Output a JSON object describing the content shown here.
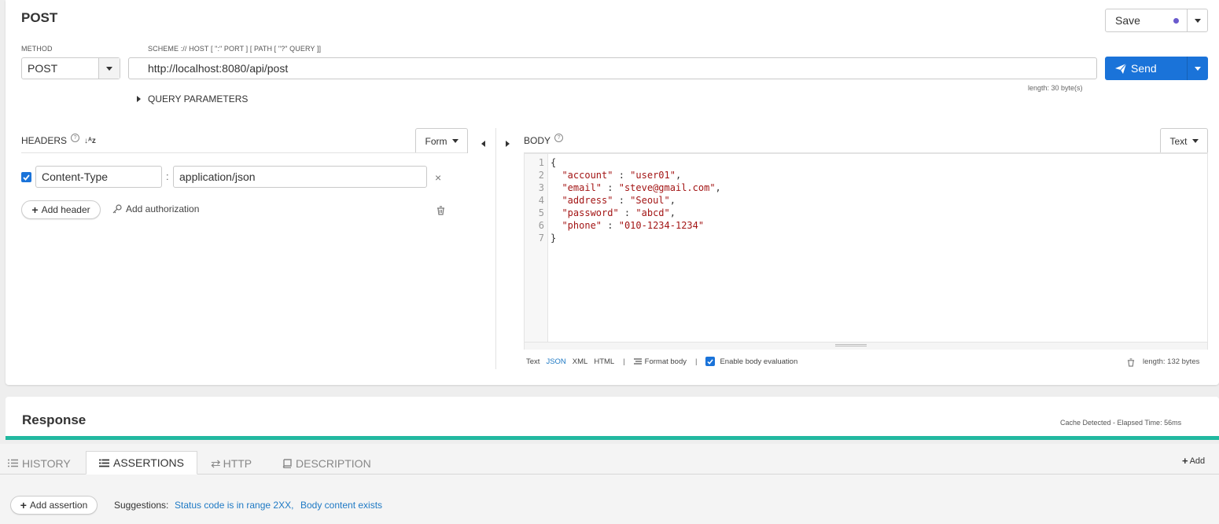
{
  "request": {
    "title": "POST",
    "save_label": "Save",
    "method_label": "METHOD",
    "method_value": "POST",
    "url_label": "SCHEME :// HOST [ \":\" PORT ] [ PATH [ \"?\" QUERY ]]",
    "url_value": "http://localhost:8080/api/post",
    "url_length": "length: 30 byte(s)",
    "send_label": "Send",
    "query_params_label": "QUERY PARAMETERS"
  },
  "headers": {
    "title": "HEADERS",
    "form_label": "Form",
    "rows": [
      {
        "checked": true,
        "name": "Content-Type",
        "value": "application/json"
      }
    ],
    "add_header_label": "Add header",
    "add_auth_label": "Add authorization"
  },
  "body": {
    "title": "BODY",
    "mode_label": "Text",
    "lines": [
      {
        "n": "1",
        "text": "{"
      },
      {
        "n": "2",
        "text": "  \"account\" : \"user01\","
      },
      {
        "n": "3",
        "text": "  \"email\" : \"steve@gmail.com\","
      },
      {
        "n": "4",
        "text": "  \"address\" : \"Seoul\","
      },
      {
        "n": "5",
        "text": "  \"password\" : \"abcd\","
      },
      {
        "n": "6",
        "text": "  \"phone\" : \"010-1234-1234\""
      },
      {
        "n": "7",
        "text": "}"
      }
    ],
    "formats": [
      "Text",
      "JSON",
      "XML",
      "HTML"
    ],
    "active_format": "JSON",
    "format_body_label": "Format body",
    "enable_eval_label": "Enable body evaluation",
    "length": "length: 132 bytes"
  },
  "response": {
    "title": "Response",
    "status": "Cache Detected - Elapsed Time: 56ms"
  },
  "tabs": {
    "history": "HISTORY",
    "assertions": "ASSERTIONS",
    "http": "HTTP",
    "description": "DESCRIPTION",
    "add": "Add"
  },
  "assertions": {
    "add_label": "Add assertion",
    "suggestions_label": "Suggestions:",
    "suggestion_1": "Status code is in range 2XX,",
    "suggestion_2": "Body content exists"
  },
  "colors": {
    "accent": "#1a73d9",
    "response_bar": "#22b8a0",
    "link": "#1e79c4",
    "string": "#a31515",
    "dot": "#6a5acd"
  }
}
